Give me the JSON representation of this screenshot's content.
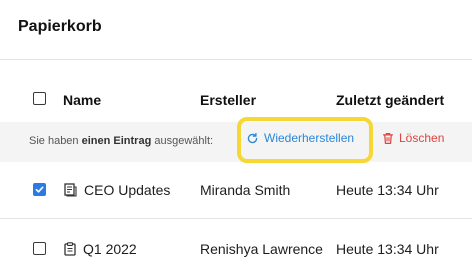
{
  "page": {
    "title": "Papierkorb"
  },
  "table": {
    "headers": {
      "name": "Name",
      "creator": "Ersteller",
      "modified": "Zuletzt geändert"
    },
    "select_all_checked": false,
    "rows": [
      {
        "name": "CEO Updates",
        "icon": "document-icon",
        "creator": "Miranda Smith",
        "modified": "Heute 13:34 Uhr",
        "checked": true
      },
      {
        "name": "Q1 2022",
        "icon": "clipboard-icon",
        "creator": "Renishya Lawrence",
        "modified": "Heute 13:34 Uhr",
        "checked": false
      }
    ]
  },
  "toolbar": {
    "selection_prefix": "Sie haben ",
    "selection_count": "einen Eintrag",
    "selection_suffix": " ausgewählt:",
    "restore_label": "Wiederherstellen",
    "restore_icon": "restore-icon",
    "delete_label": "Löschen",
    "delete_icon": "trash-icon"
  },
  "colors": {
    "accent": "#2a86d9",
    "danger": "#e0433f",
    "highlight": "#f6d733",
    "checkbox_checked": "#2a7be4",
    "toolbar_bg": "#f4f4f5"
  }
}
